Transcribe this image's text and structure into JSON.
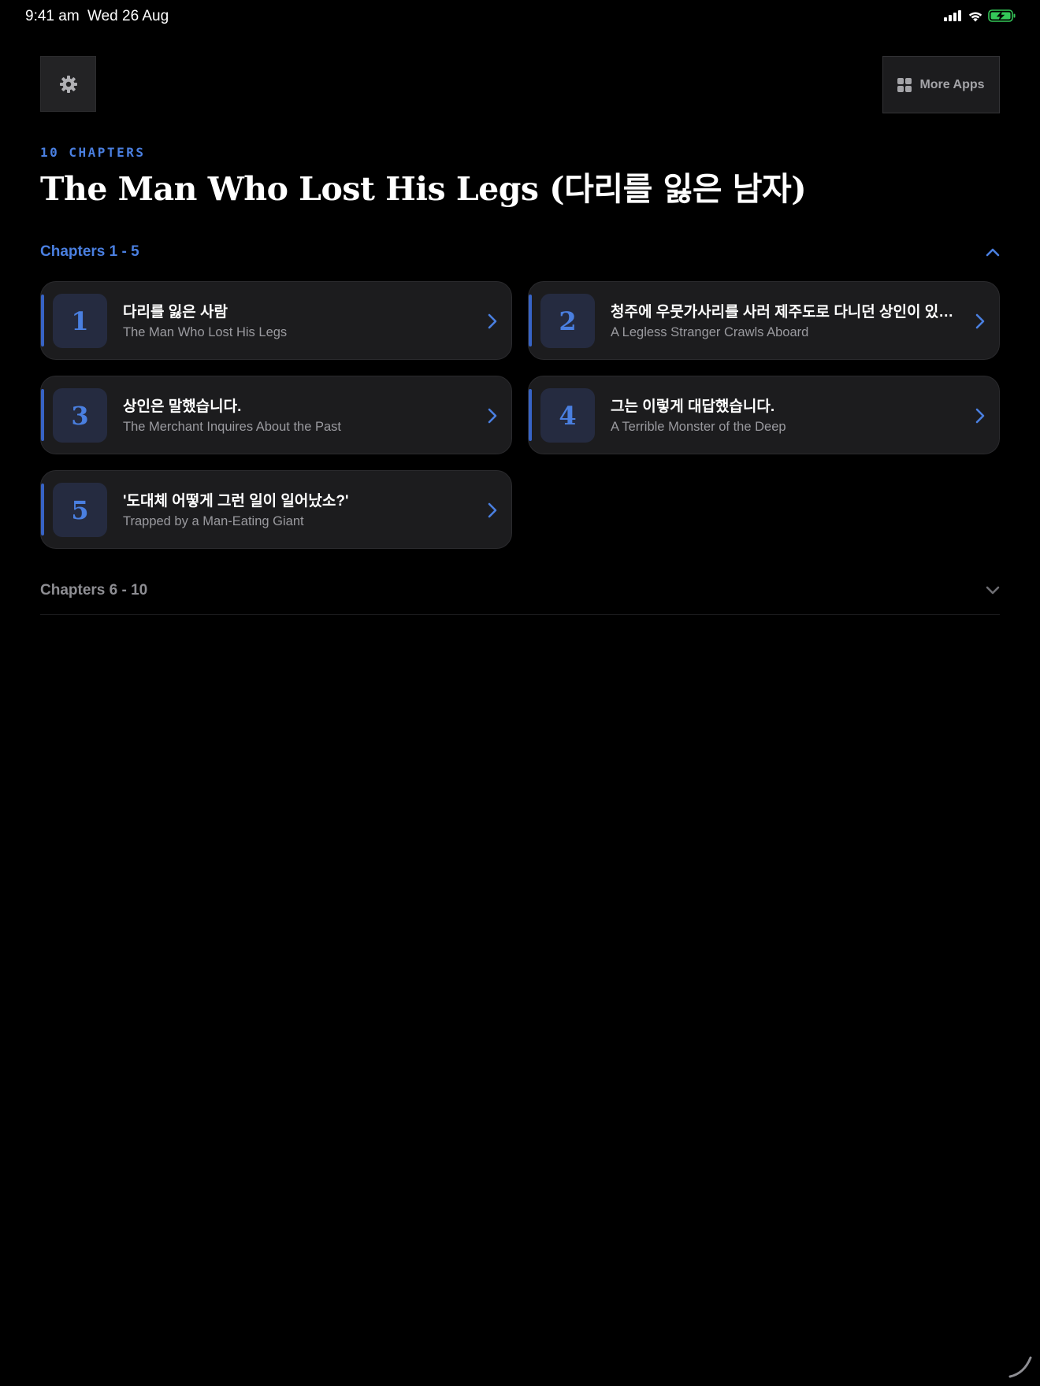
{
  "status_bar": {
    "time": "9:41 am",
    "date": "Wed 26 Aug"
  },
  "header": {
    "settings_icon": "gear-icon",
    "more_apps_icon": "grid-icon",
    "more_apps_label": "More Apps"
  },
  "book": {
    "chapter_count": "10 CHAPTERS",
    "title": "The Man Who Lost His Legs (다리를 잃은 남자)"
  },
  "sections": [
    {
      "label": "Chapters 1 - 5",
      "expanded": true,
      "chevron_icon": "chevron-up-icon",
      "chapters": [
        {
          "number": "1",
          "title": "다리를 잃은 사람",
          "subtitle": "The Man Who Lost His Legs"
        },
        {
          "number": "2",
          "title": "청주에 우뭇가사리를 사러 제주도로 다니던 상인이 있었습니다.",
          "subtitle": "A Legless Stranger Crawls Aboard"
        },
        {
          "number": "3",
          "title": "상인은 말했습니다.",
          "subtitle": "The Merchant Inquires About the Past"
        },
        {
          "number": "4",
          "title": "그는 이렇게 대답했습니다.",
          "subtitle": "A Terrible Monster of the Deep"
        },
        {
          "number": "5",
          "title": "'도대체 어떻게 그런 일이 일어났소?'",
          "subtitle": "Trapped by a Man-Eating Giant"
        }
      ]
    },
    {
      "label": "Chapters 6 - 10",
      "expanded": false,
      "chevron_icon": "chevron-down-icon"
    }
  ],
  "colors": {
    "accent": "#4a7fe0",
    "background": "#000000",
    "card": "#1c1c1e",
    "battery": "#34c759"
  }
}
